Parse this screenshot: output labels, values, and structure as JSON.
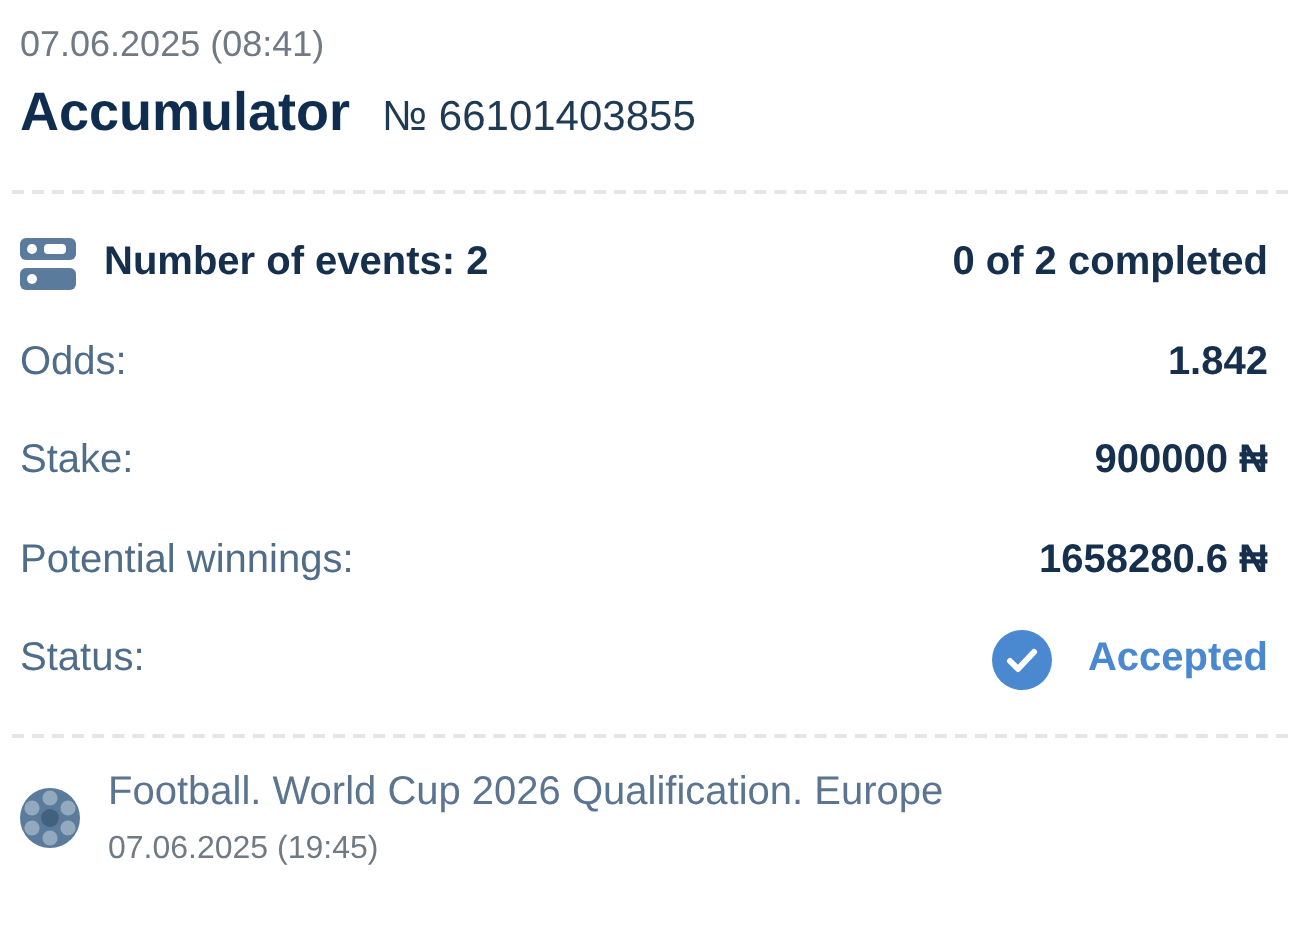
{
  "bet": {
    "date": "07.06.2025 (08:41)",
    "type": "Accumulator",
    "number": "№ 66101403855"
  },
  "summary": {
    "events_label": "Number of events: 2",
    "progress": "0 of 2 completed"
  },
  "rows": [
    {
      "label": "Odds:",
      "value": "1.842"
    },
    {
      "label": "Stake:",
      "value": "900000 ₦"
    },
    {
      "label": "Potential winnings:",
      "value": "1658280.6 ₦"
    }
  ],
  "status": {
    "label": "Status:",
    "value": "Accepted",
    "kind": "accepted"
  },
  "events": [
    {
      "title": "Football. World Cup 2026 Qualification. Europe",
      "date": "07.06.2025 (19:45)"
    }
  ]
}
